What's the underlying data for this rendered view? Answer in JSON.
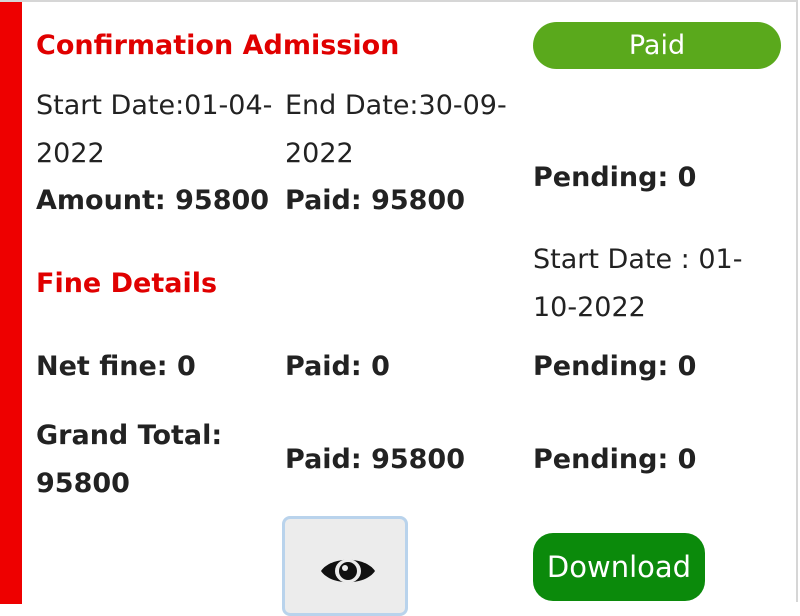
{
  "section_title": "Confirmation Admission",
  "status_badge": "Paid",
  "admission": {
    "start_date": "Start Date:01-04-2022",
    "end_date": "End Date:30-09-2022",
    "amount": "Amount: 95800",
    "paid": "Paid: 95800",
    "pending": "Pending: 0"
  },
  "fine": {
    "title": "Fine Details",
    "start_date": "Start Date : 01-10-2022",
    "net_fine": "Net fine: 0",
    "paid": "Paid: 0",
    "pending": "Pending: 0"
  },
  "total": {
    "grand_total": "Grand Total: 95800",
    "paid": "Paid: 95800",
    "pending": "Pending: 0"
  },
  "actions": {
    "view_icon": "eye-icon",
    "download_label": "Download"
  },
  "colors": {
    "accent": "#ee0000",
    "title_red": "#e00000",
    "badge_green": "#5aa91c",
    "download_green": "#0b8a0b"
  }
}
